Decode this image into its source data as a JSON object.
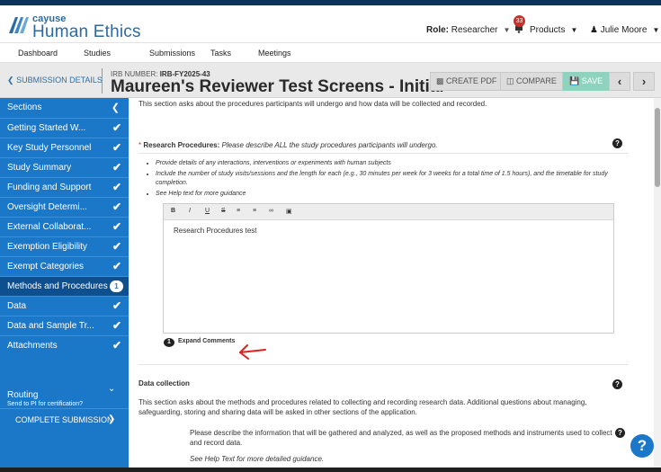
{
  "header": {
    "brand_small": "cayuse",
    "brand_big": "Human Ethics",
    "role_label": "Role:",
    "role_value": "Researcher",
    "notifications_count": "33",
    "products_label": "Products",
    "user_name": "Julie Moore"
  },
  "nav": {
    "items": [
      "Dashboard",
      "Studies",
      "Submissions",
      "Tasks",
      "Meetings"
    ]
  },
  "subheader": {
    "back_label": "SUBMISSION DETAILS",
    "irb_prefix": "IRB NUMBER:",
    "irb_number": "IRB-FY2025-43",
    "title": "Maureen's Reviewer Test Screens - Initial",
    "create_pdf": "CREATE PDF",
    "compare": "COMPARE",
    "save": "SAVE"
  },
  "sidebar": {
    "heading": "Sections",
    "items": [
      {
        "label": "Getting Started W...",
        "status": "complete"
      },
      {
        "label": "Key Study Personnel",
        "status": "complete"
      },
      {
        "label": "Study Summary",
        "status": "complete"
      },
      {
        "label": "Funding and Support",
        "status": "complete"
      },
      {
        "label": "Oversight Determi...",
        "status": "complete"
      },
      {
        "label": "External Collaborat...",
        "status": "complete"
      },
      {
        "label": "Exemption Eligibility",
        "status": "complete"
      },
      {
        "label": "Exempt Categories",
        "status": "complete"
      },
      {
        "label": "Methods and Procedures",
        "status": "active",
        "comments": "1"
      },
      {
        "label": "Data",
        "status": "complete"
      },
      {
        "label": "Data and Sample Tr...",
        "status": "complete"
      },
      {
        "label": "Attachments",
        "status": "complete"
      }
    ],
    "routing_label": "Routing",
    "routing_sub": "Send to PI for certification?",
    "complete_label": "COMPLETE SUBMISSION"
  },
  "content": {
    "intro": "This section asks about the procedures participants will undergo and how data will be collected and recorded.",
    "rp_label": "Research Procedures:",
    "rp_desc": "Please describe ALL the study procedures participants will undergo.",
    "bullets": [
      "Provide details of any interactions, interventions or experiments with human subjects",
      "Include the number of study visits/sessions and the length for each (e.g., 30 minutes per week for 3 weeks for a total time of 1.5 hours), and the timetable for study completion.",
      "See Help text for more guidance"
    ],
    "editor_text": "Research Procedures test",
    "comment_count": "1",
    "expand_comments": "Expand Comments",
    "dc_title": "Data collection",
    "dc_desc": "This section asks about the methods and procedures related to collecting and recording research data. Additional questions about managing, safeguarding, storing and sharing data will be asked in other sections of the application.",
    "dc_question": "Please describe the information that will be gathered and analyzed, as well as the proposed methods and instruments used to collect and record data.",
    "dc_help": "See Help Text for more detailed guidance."
  },
  "colors": {
    "sidebar_blue": "#1b77c8",
    "active_item": "#0e4f8f",
    "brand": "#2b6aa3",
    "save_button": "#8fd3bf",
    "badge_red": "#c9302c"
  }
}
